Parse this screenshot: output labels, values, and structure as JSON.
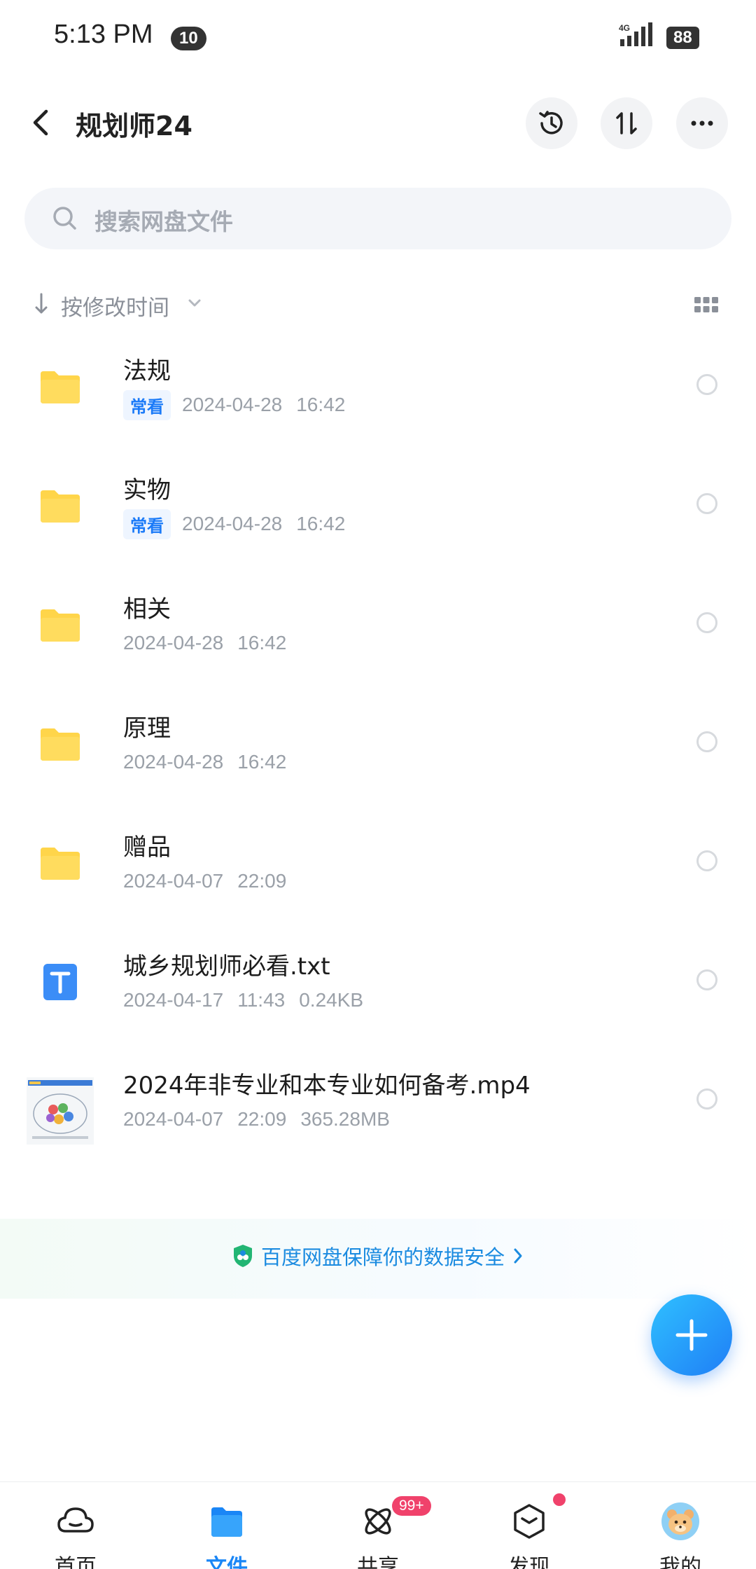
{
  "status_bar": {
    "time": "5:13 PM",
    "notification_count": "10",
    "network": "4G",
    "battery": "88"
  },
  "header": {
    "title": "规划师24",
    "icons": [
      "back-icon",
      "history-icon",
      "sort-icon",
      "more-icon"
    ]
  },
  "search": {
    "placeholder": "搜索网盘文件"
  },
  "sort": {
    "label": "按修改时间"
  },
  "files": [
    {
      "name": "法规",
      "type": "folder",
      "tag": "常看",
      "date": "2024-04-28",
      "time": "16:42",
      "size": ""
    },
    {
      "name": "实物",
      "type": "folder",
      "tag": "常看",
      "date": "2024-04-28",
      "time": "16:42",
      "size": ""
    },
    {
      "name": "相关",
      "type": "folder",
      "tag": "",
      "date": "2024-04-28",
      "time": "16:42",
      "size": ""
    },
    {
      "name": "原理",
      "type": "folder",
      "tag": "",
      "date": "2024-04-28",
      "time": "16:42",
      "size": ""
    },
    {
      "name": "赠品",
      "type": "folder",
      "tag": "",
      "date": "2024-04-07",
      "time": "22:09",
      "size": ""
    },
    {
      "name": "城乡规划师必看.txt",
      "type": "txt",
      "tag": "",
      "date": "2024-04-17",
      "time": "11:43",
      "size": "0.24KB"
    },
    {
      "name": "2024年非专业和本专业如何备考.mp4",
      "type": "video",
      "tag": "",
      "date": "2024-04-07",
      "time": "22:09",
      "size": "365.28MB"
    }
  ],
  "banner": {
    "text": "百度网盘保障你的数据安全"
  },
  "nav": {
    "items": [
      {
        "label": "首页",
        "icon": "cloud-icon",
        "active": false
      },
      {
        "label": "文件",
        "icon": "folder-icon",
        "active": true
      },
      {
        "label": "共享",
        "icon": "share-icon",
        "active": false,
        "badge": "99+"
      },
      {
        "label": "发现",
        "icon": "discover-icon",
        "active": false
      },
      {
        "label": "我的",
        "icon": "avatar-icon",
        "active": false
      }
    ]
  },
  "colors": {
    "accent": "#1a86f6",
    "folder": "#ffd54a",
    "badge": "#f0426b"
  }
}
